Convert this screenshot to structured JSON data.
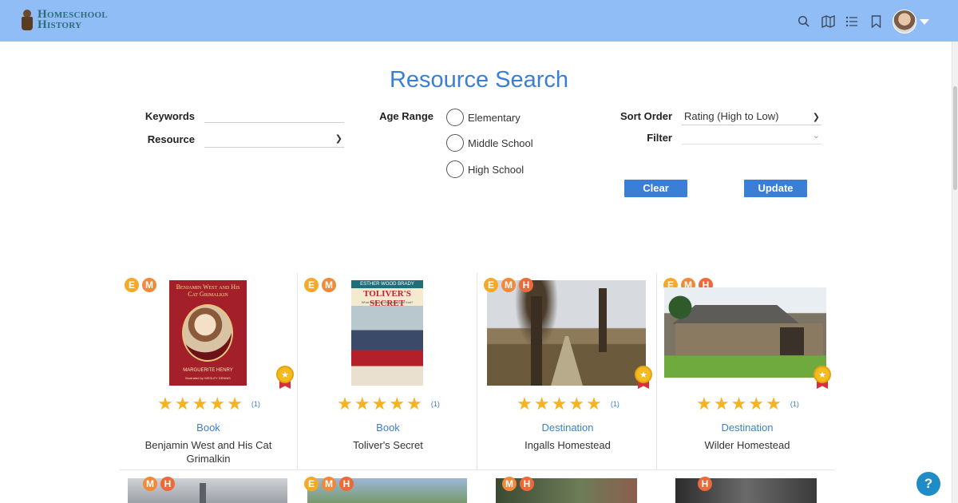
{
  "header": {
    "logo_line1": "Homeschool",
    "logo_line2": "History"
  },
  "page": {
    "title": "Resource Search"
  },
  "form": {
    "keywords_label": "Keywords",
    "keywords_value": "",
    "resource_label": "Resource",
    "resource_value": "",
    "age_range_label": "Age Range",
    "age_options": [
      "Elementary",
      "Middle School",
      "High School"
    ],
    "sort_label": "Sort Order",
    "sort_value": "Rating (High to Low)",
    "filter_label": "Filter",
    "filter_value": "",
    "clear_label": "Clear",
    "update_label": "Update"
  },
  "results": [
    {
      "badges": [
        "E",
        "M"
      ],
      "type": "Book",
      "title": "Benjamin West and His Cat Grimalkin",
      "rating": 5,
      "rating_count": "(1)",
      "award": true,
      "cover": {
        "title": "Benjamin West and His Cat Grimalkin",
        "author": "MARGUERITE HENRY",
        "illustrator": "Illustrated by WESLEY DENNIS"
      }
    },
    {
      "badges": [
        "E",
        "M"
      ],
      "type": "Book",
      "title": "Toliver's Secret",
      "rating": 5,
      "rating_count": "(1)",
      "award": false,
      "cover": {
        "author": "ESTHER WOOD BRADY",
        "title": "TOLIVER'S SECRET",
        "tagline": "What would be like carrying on that?"
      }
    },
    {
      "badges": [
        "E",
        "M",
        "H"
      ],
      "type": "Destination",
      "title": "Ingalls Homestead",
      "rating": 5,
      "rating_count": "(1)",
      "award": true
    },
    {
      "badges": [
        "E",
        "M",
        "H"
      ],
      "type": "Destination",
      "title": "Wilder Homestead",
      "rating": 5,
      "rating_count": "(1)",
      "award": true
    }
  ],
  "results_row2": [
    {
      "badges": [
        "M",
        "H"
      ]
    },
    {
      "badges": [
        "E",
        "M",
        "H"
      ]
    },
    {
      "badges": [
        "M",
        "H"
      ]
    },
    {
      "badges": [
        "H"
      ]
    }
  ],
  "help_label": "?",
  "colors": {
    "accent": "#3a7fd5",
    "header_bg": "#90bdf6",
    "star": "#f5b321"
  }
}
